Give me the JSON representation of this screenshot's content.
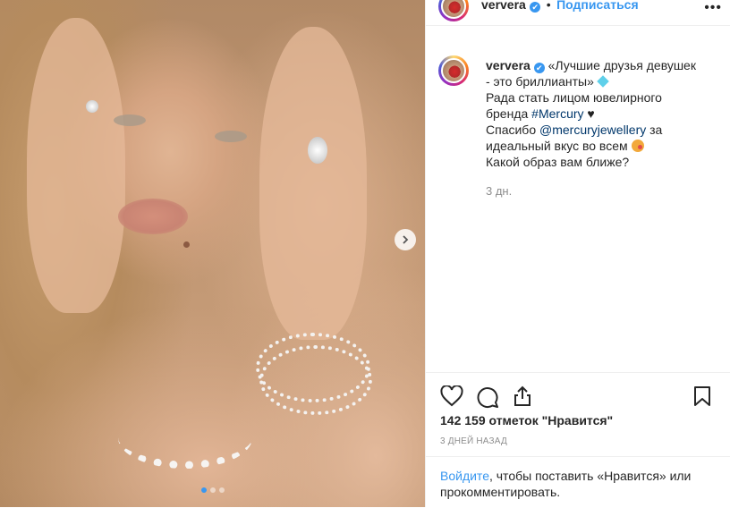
{
  "post": {
    "username": "ververa",
    "follow_label": "Подписаться",
    "separator": "•",
    "more_icon": "more-horizontal-icon",
    "verified_mark": "✔"
  },
  "caption": {
    "username": "ververa",
    "line1": "«Лучшие друзья девушек",
    "line2": "- это бриллианты»",
    "line3": "Рада стать лицом ювелирного",
    "line4_pre": "бренда ",
    "hashtag": "#Mercury",
    "line5_pre": "Спасибо ",
    "mention": "@mercuryjewellery",
    "line5_post": " за",
    "line6": "идеальный вкус во всем",
    "line7": "Какой образ вам ближе?",
    "time_ago": "3 дн."
  },
  "stats": {
    "likes": "142 159 отметок \"Нравится\"",
    "date": "3 ДНЕЙ НАЗАД"
  },
  "login": {
    "link": "Войдите",
    "rest": ", чтобы поставить «Нравится» или прокомментировать."
  },
  "carousel": {
    "count": 3,
    "active_index": 0
  },
  "colors": {
    "accent": "#3897f0",
    "link": "#00376b",
    "muted": "#8e8e8e",
    "text": "#262626"
  }
}
